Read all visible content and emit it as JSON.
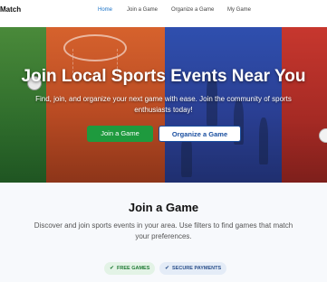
{
  "nav": {
    "brand": "Match",
    "links": [
      {
        "label": "Home",
        "active": true
      },
      {
        "label": "Join a Game"
      },
      {
        "label": "Organize a Game"
      },
      {
        "label": "My Game"
      }
    ]
  },
  "hero": {
    "title": "Join Local Sports Events Near You",
    "subtitle": "Find, join, and organize your next game with ease. Join the community of sports enthusiasts today!",
    "join_button": "Join a Game",
    "organize_button": "Organize a Game"
  },
  "section": {
    "title": "Join a Game",
    "text": "Discover and join sports events in your area. Use filters to find games that match your preferences.",
    "badges": [
      {
        "label": "FREE GAMES",
        "icon": "check-circle-icon"
      },
      {
        "label": "SECURE PAYMENTS",
        "icon": "shield-check-icon"
      }
    ]
  },
  "colors": {
    "accent": "#1a73c8",
    "join_green": "#1e9a3e",
    "organize_blue": "#1a4fa0"
  }
}
